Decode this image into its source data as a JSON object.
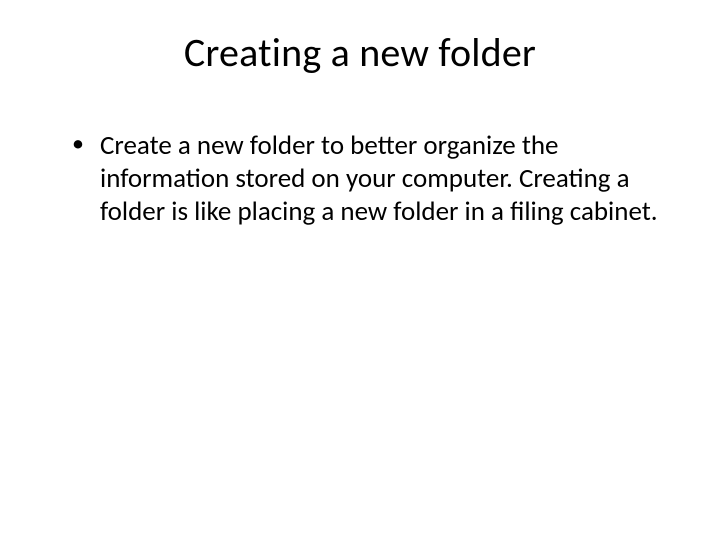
{
  "slide": {
    "title": "Creating a new folder",
    "bullets": [
      "Create a new folder to better organize the information stored on your computer. Creating a folder is like placing a new folder in a filing cabinet."
    ]
  }
}
